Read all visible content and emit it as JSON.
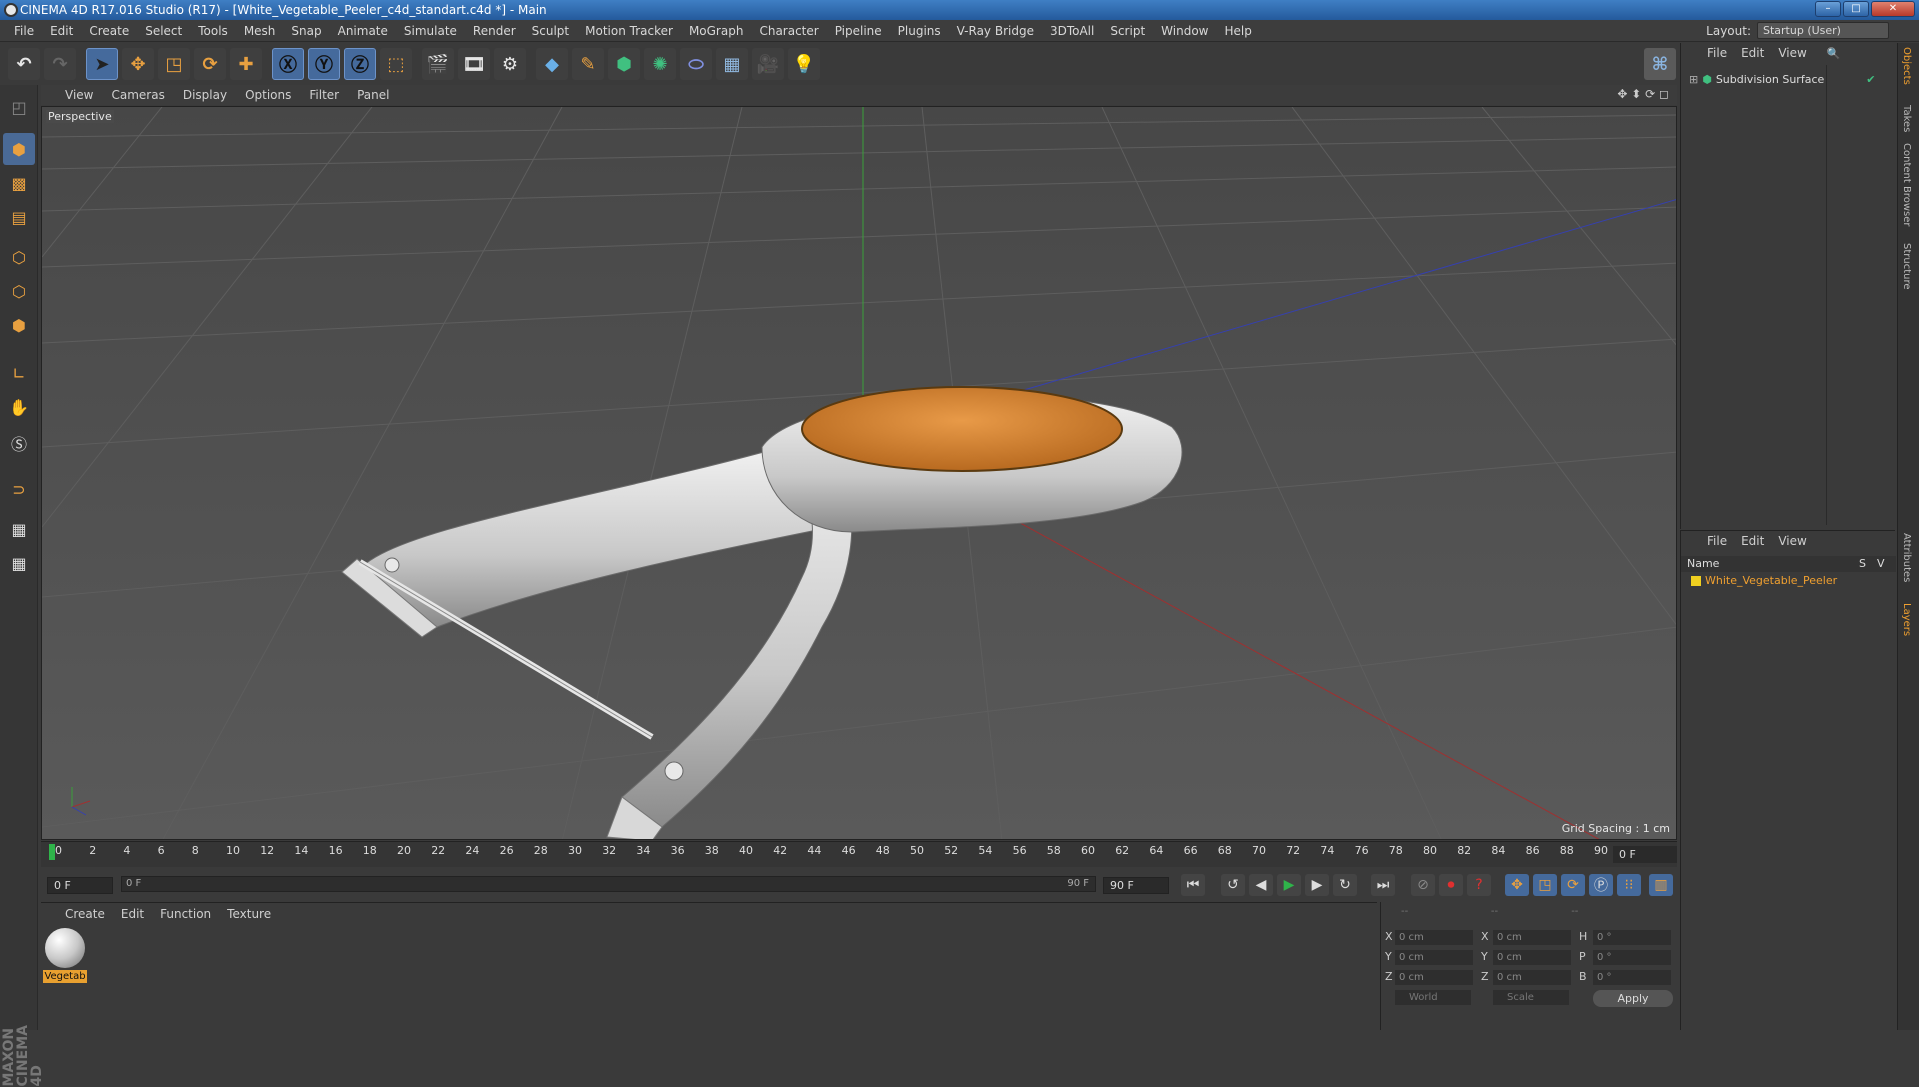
{
  "window": {
    "title": "CINEMA 4D R17.016 Studio (R17) - [White_Vegetable_Peeler_c4d_standart.c4d *] - Main"
  },
  "menu": [
    "File",
    "Edit",
    "Create",
    "Select",
    "Tools",
    "Mesh",
    "Snap",
    "Animate",
    "Simulate",
    "Render",
    "Sculpt",
    "Motion Tracker",
    "MoGraph",
    "Character",
    "Pipeline",
    "Plugins",
    "V-Ray Bridge",
    "3DToAll",
    "Script",
    "Window",
    "Help"
  ],
  "layout": {
    "label": "Layout:",
    "value": "Startup (User)"
  },
  "viewport": {
    "menu": [
      "View",
      "Cameras",
      "Display",
      "Options",
      "Filter",
      "Panel"
    ],
    "label": "Perspective",
    "grid_spacing": "Grid Spacing : 1 cm"
  },
  "timeline": {
    "ticks": [
      "0",
      "2",
      "4",
      "6",
      "8",
      "10",
      "12",
      "14",
      "16",
      "18",
      "20",
      "22",
      "24",
      "26",
      "28",
      "30",
      "32",
      "34",
      "36",
      "38",
      "40",
      "42",
      "44",
      "46",
      "48",
      "50",
      "52",
      "54",
      "56",
      "58",
      "60",
      "62",
      "64",
      "66",
      "68",
      "70",
      "72",
      "74",
      "76",
      "78",
      "80",
      "82",
      "84",
      "86",
      "88",
      "90"
    ],
    "current": "0 F",
    "start": "0 F",
    "slider_from": "0 F",
    "slider_to": "90 F",
    "end": "90 F"
  },
  "material": {
    "menu": [
      "Create",
      "Edit",
      "Function",
      "Texture"
    ],
    "item": "Vegetab"
  },
  "coords": {
    "rows": [
      {
        "a": "X",
        "av": "0 cm",
        "b": "X",
        "bv": "0 cm",
        "c": "H",
        "cv": "0 °"
      },
      {
        "a": "Y",
        "av": "0 cm",
        "b": "Y",
        "bv": "0 cm",
        "c": "P",
        "cv": "0 °"
      },
      {
        "a": "Z",
        "av": "0 cm",
        "b": "Z",
        "bv": "0 cm",
        "c": "B",
        "cv": "0 °"
      }
    ],
    "mode": "World",
    "size": "Scale",
    "apply": "Apply"
  },
  "objects": {
    "menu": [
      "File",
      "Edit",
      "View"
    ],
    "item": "Subdivision Surface"
  },
  "layers": {
    "menu": [
      "File",
      "Edit",
      "View"
    ],
    "col_name": "Name",
    "col_s": "S",
    "col_v": "V",
    "item": "White_Vegetable_Peeler"
  },
  "side_tabs": [
    "Objects",
    "Takes",
    "Content Browser",
    "Structure",
    "Attributes",
    "Layers"
  ],
  "brand": "MAXON CINEMA 4D",
  "colors": {
    "accent": "#f0a030",
    "viewport": "#4e4e4e",
    "x_axis": "#b03030",
    "y_axis": "#30a030",
    "z_axis": "#3040b0"
  }
}
